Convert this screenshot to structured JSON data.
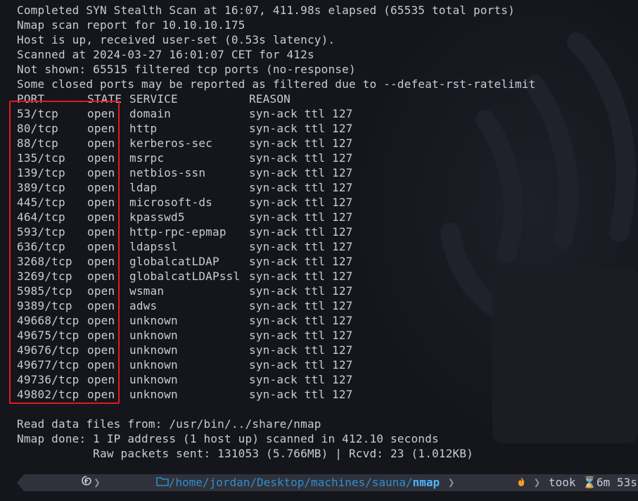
{
  "header_lines": [
    "Completed SYN Stealth Scan at 16:07, 411.98s elapsed (65535 total ports)",
    "Nmap scan report for 10.10.10.175",
    "Host is up, received user-set (0.53s latency).",
    "Scanned at 2024-03-27 16:01:07 CET for 412s",
    "Not shown: 65515 filtered tcp ports (no-response)",
    "Some closed ports may be reported as filtered due to --defeat-rst-ratelimit"
  ],
  "table": {
    "headers": [
      "PORT",
      "STATE",
      "SERVICE",
      "REASON"
    ],
    "rows": [
      [
        "53/tcp",
        "open",
        "domain",
        "syn-ack ttl 127"
      ],
      [
        "80/tcp",
        "open",
        "http",
        "syn-ack ttl 127"
      ],
      [
        "88/tcp",
        "open",
        "kerberos-sec",
        "syn-ack ttl 127"
      ],
      [
        "135/tcp",
        "open",
        "msrpc",
        "syn-ack ttl 127"
      ],
      [
        "139/tcp",
        "open",
        "netbios-ssn",
        "syn-ack ttl 127"
      ],
      [
        "389/tcp",
        "open",
        "ldap",
        "syn-ack ttl 127"
      ],
      [
        "445/tcp",
        "open",
        "microsoft-ds",
        "syn-ack ttl 127"
      ],
      [
        "464/tcp",
        "open",
        "kpasswd5",
        "syn-ack ttl 127"
      ],
      [
        "593/tcp",
        "open",
        "http-rpc-epmap",
        "syn-ack ttl 127"
      ],
      [
        "636/tcp",
        "open",
        "ldapssl",
        "syn-ack ttl 127"
      ],
      [
        "3268/tcp",
        "open",
        "globalcatLDAP",
        "syn-ack ttl 127"
      ],
      [
        "3269/tcp",
        "open",
        "globalcatLDAPssl",
        "syn-ack ttl 127"
      ],
      [
        "5985/tcp",
        "open",
        "wsman",
        "syn-ack ttl 127"
      ],
      [
        "9389/tcp",
        "open",
        "adws",
        "syn-ack ttl 127"
      ],
      [
        "49668/tcp",
        "open",
        "unknown",
        "syn-ack ttl 127"
      ],
      [
        "49675/tcp",
        "open",
        "unknown",
        "syn-ack ttl 127"
      ],
      [
        "49676/tcp",
        "open",
        "unknown",
        "syn-ack ttl 127"
      ],
      [
        "49677/tcp",
        "open",
        "unknown",
        "syn-ack ttl 127"
      ],
      [
        "49736/tcp",
        "open",
        "unknown",
        "syn-ack ttl 127"
      ],
      [
        "49802/tcp",
        "open",
        "unknown",
        "syn-ack ttl 127"
      ]
    ]
  },
  "footer_lines": [
    "Read data files from: /usr/bin/../share/nmap",
    "Nmap done: 1 IP address (1 host up) scanned in 412.10 seconds",
    "           Raw packets sent: 131053 (5.766MB) | Rcvd: 23 (1.012KB)"
  ],
  "prompt": {
    "os_icon": "debian-swirl-icon",
    "folder_icon": "folder-icon",
    "path_prefix": "/home/jordan/Desktop/machines/sauna/",
    "path_current": "nmap",
    "took_label": "took",
    "duration": "6m 53s",
    "status_mark": "✔",
    "colors": {
      "path": "#2f8ecd",
      "ok": "#5fd75f",
      "highlight_box": "#e4191b"
    }
  }
}
